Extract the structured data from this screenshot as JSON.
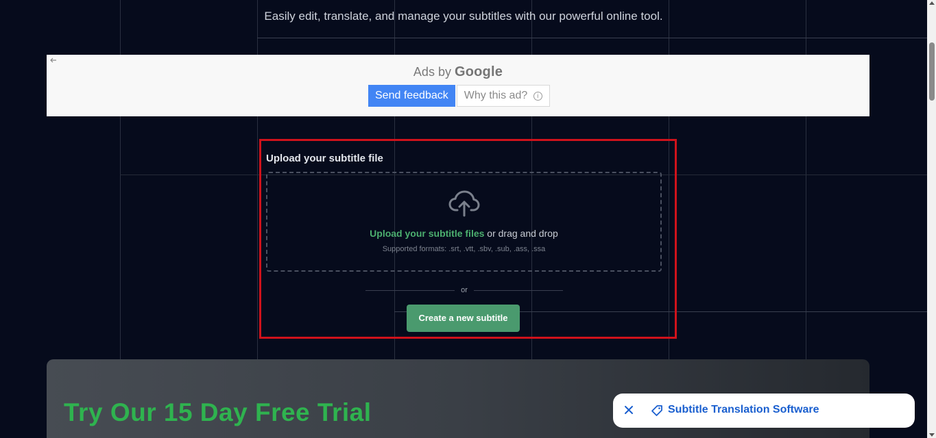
{
  "header": {
    "tagline": "Easily edit, translate, and manage your subtitles with our powerful online tool."
  },
  "ad": {
    "ads_by": "Ads by",
    "google": "Google",
    "send_feedback": "Send feedback",
    "why_this_ad": "Why this ad?",
    "back_icon": "arrow-left-icon",
    "info_icon": "info-icon"
  },
  "upload": {
    "title": "Upload your subtitle file",
    "link_text": "Upload your subtitle files",
    "drag_text": " or drag and drop",
    "formats": "Supported formats: .srt, .vtt, .sbv, .sub, .ass, .ssa",
    "or": "or",
    "create_button": "Create a new subtitle",
    "icon": "cloud-upload-icon"
  },
  "trial": {
    "title": "Try Our 15 Day Free Trial"
  },
  "chip": {
    "label": "Subtitle Translation Software",
    "close_icon": "close-icon",
    "tag_icon": "tag-icon"
  },
  "colors": {
    "background": "#060b1c",
    "accent_green": "#4caf6f",
    "button_green": "#4a9a6e",
    "trial_green": "#2fb34f",
    "highlight_red": "#d0121b",
    "google_blue": "#4285f4",
    "chip_text_blue": "#1a5fcf"
  }
}
